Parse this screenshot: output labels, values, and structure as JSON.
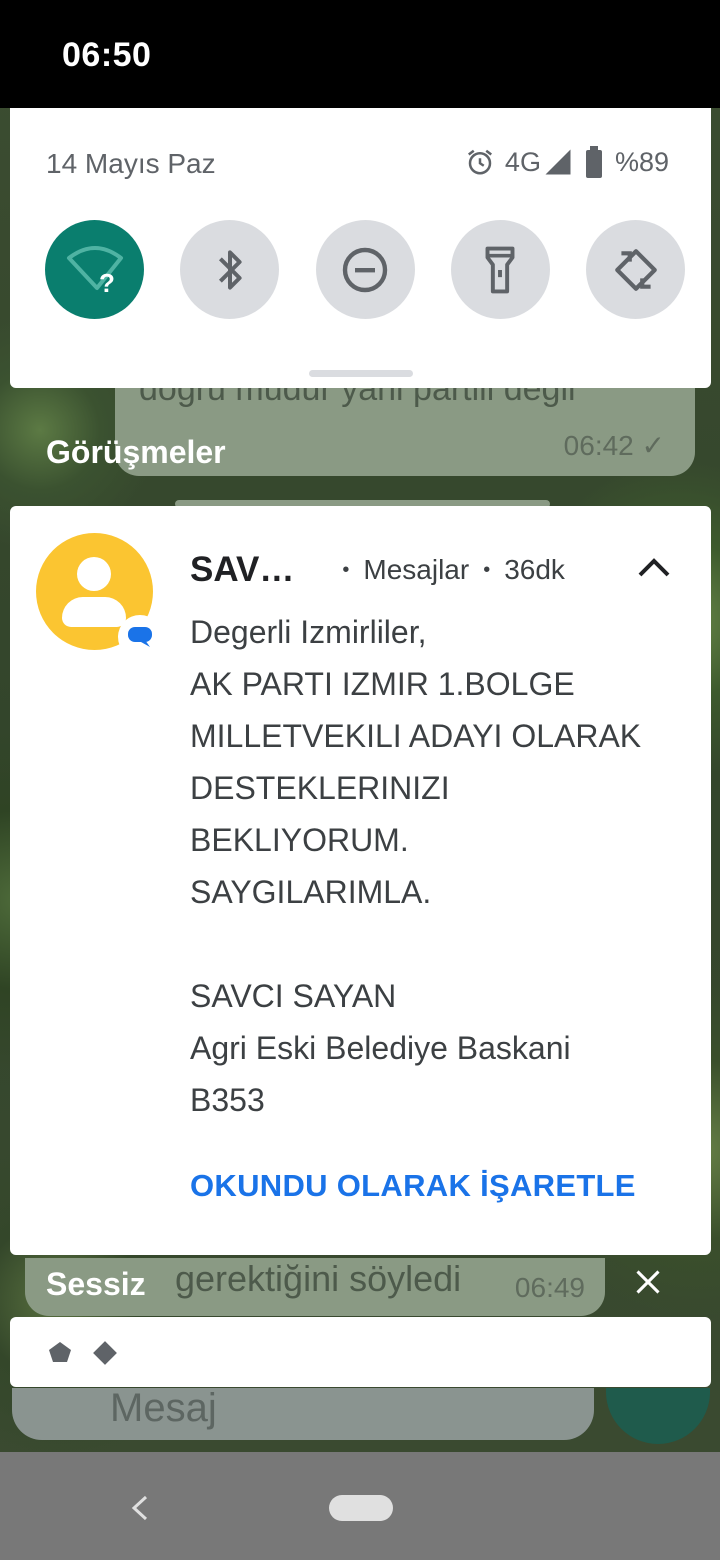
{
  "status_bar": {
    "time": "06:50"
  },
  "quick_settings": {
    "date": "14 Mayıs Paz",
    "network": "4G",
    "battery": "%89",
    "tiles": [
      {
        "name": "wifi-icon",
        "active": true
      },
      {
        "name": "bluetooth-icon",
        "active": false
      },
      {
        "name": "do-not-disturb-icon",
        "active": false
      },
      {
        "name": "flashlight-icon",
        "active": false
      },
      {
        "name": "auto-rotate-icon",
        "active": false
      }
    ]
  },
  "background_chat": {
    "message_partial": "doğru mudur yani partili değil",
    "message_time": "06:42",
    "lower_message_partial": "gerektiğini söyledi",
    "lower_message_time": "06:49",
    "input_placeholder": "Mesaj"
  },
  "sections": {
    "conversations": "Görüşmeler",
    "silent": "Sessiz"
  },
  "notification": {
    "sender": "SAV…",
    "app": "Mesajlar",
    "age": "36dk",
    "message": "Degerli Izmirliler,\nAK PARTI IZMIR 1.BOLGE MILLETVEKILI ADAYI OLARAK DESTEKLERINIZI BEKLIYORUM.\nSAYGILARIMLA.\n\nSAVCI SAYAN\nAgri Eski Belediye Baskani\nB353",
    "action": "OKUNDU OLARAK İŞARETLE"
  },
  "colors": {
    "accent_teal": "#0a7e6e",
    "action_blue": "#1a73e8",
    "avatar_yellow": "#fbc531"
  }
}
